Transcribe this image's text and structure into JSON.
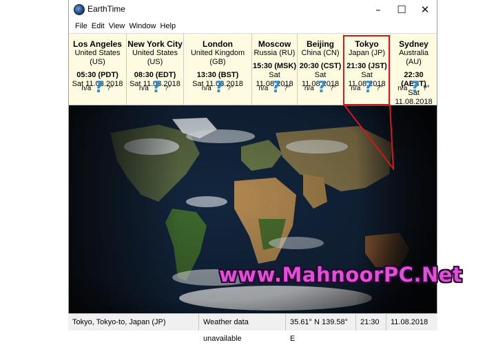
{
  "window": {
    "title": "EarthTime"
  },
  "menu": [
    "File",
    "Edit",
    "View",
    "Window",
    "Help"
  ],
  "cities": [
    {
      "name": "Los Angeles",
      "country": "United States (US)",
      "time": "05:30 (PDT)",
      "date": "Sat 11.08.2018",
      "weather": "n/a",
      "temp": "?°"
    },
    {
      "name": "New York City",
      "country": "United States (US)",
      "time": "08:30 (EDT)",
      "date": "Sat 11.08.2018",
      "weather": "n/a",
      "temp": "?°"
    },
    {
      "name": "London",
      "country": "United Kingdom (GB)",
      "time": "13:30 (BST)",
      "date": "Sat 11.08.2018",
      "weather": "n/a",
      "temp": "?°"
    },
    {
      "name": "Moscow",
      "country": "Russia (RU)",
      "time": "15:30 (MSK)",
      "date": "Sat 11.08.2018",
      "weather": "n/a",
      "temp": "?°"
    },
    {
      "name": "Beijing",
      "country": "China (CN)",
      "time": "20:30 (CST)",
      "date": "Sat 11.08.2018",
      "weather": "n/a",
      "temp": "?°"
    },
    {
      "name": "Tokyo",
      "country": "Japan (JP)",
      "time": "21:30 (JST)",
      "date": "Sat 11.08.2018",
      "weather": "n/a",
      "temp": "?°"
    },
    {
      "name": "Sydney",
      "country": "Australia (AU)",
      "time": "22:30 (AEST)",
      "date": "Sat 11.08.2018",
      "weather": "n/a",
      "temp": "?°"
    }
  ],
  "status": {
    "location": "Tokyo, Tokyo-to, Japan (JP)",
    "weather": "Weather data unavailable",
    "coords": "35.61° N  139.58° E",
    "time": "21:30",
    "date": "11.08.2018"
  },
  "watermark": "www.MahnoorPC.Net",
  "colors": {
    "highlight": "#d21a1a",
    "panel": "#fffbe0",
    "watermark": "#e04fd8",
    "weather_icon": "#2e8bd6"
  },
  "icons": {
    "weather": "question-mark-icon",
    "app": "globe-icon"
  }
}
